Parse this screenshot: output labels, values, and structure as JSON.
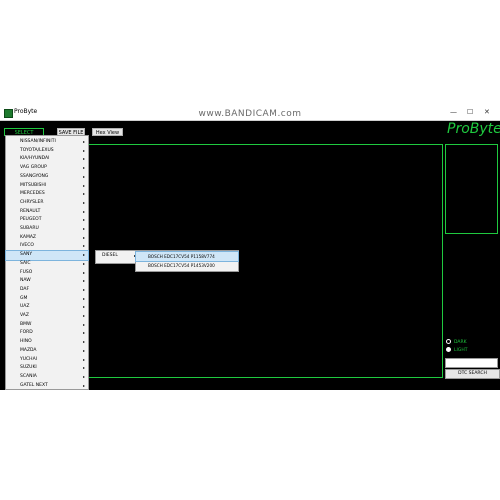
{
  "window": {
    "title": "ProByte",
    "watermark": "www.BANDICAM.com",
    "controls": [
      "—",
      "☐",
      "✕"
    ]
  },
  "toolbar": {
    "select_module": "SELECT MODULE",
    "save_file": "SAVE FILE",
    "hex_view": "Hex View"
  },
  "brand": "ProByte",
  "menu": {
    "items": [
      "NISSAN/INFINITI",
      "TOYOTA/LEXUS",
      "KIA/HYUNDAI",
      "VAG GROUP",
      "SSANGYONG",
      "MITSUBISHI",
      "MERCEDES",
      "CHRYSLER",
      "RENAULT",
      "PEUGEOT",
      "SUBARU",
      "KAMAZ",
      "IVECO",
      "SANY",
      "SAIC",
      "FUSO",
      "NAW",
      "DAF",
      "GM",
      "UAZ",
      "VAZ",
      "BMW",
      "FORD",
      "HINO",
      "MAZDA",
      "YUCHAI",
      "SUZUKI",
      "SCANIA",
      "GATEL NEXT"
    ],
    "highlighted": "SANY",
    "arrow": "▸"
  },
  "submenu": {
    "label": "DIESEL"
  },
  "submenu2": {
    "items": [
      "BOSCH EDC17CV54 P1158V774",
      "BOSCH EDC17CV54 P1453V200"
    ]
  },
  "options": {
    "dark": "DARK",
    "light": "LIGHT",
    "selected": "LIGHT"
  },
  "dtc": {
    "value": "",
    "button": "DTC SEARCH"
  }
}
